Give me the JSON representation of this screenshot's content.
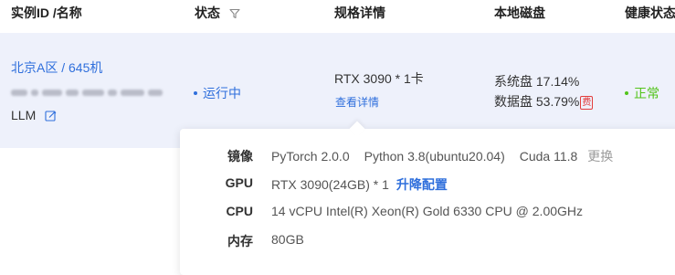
{
  "header": {
    "col_instance": "实例ID /名称",
    "col_status": "状态",
    "col_spec": "规格详情",
    "col_disk": "本地磁盘",
    "col_health": "健康状态"
  },
  "row": {
    "region": "北京A区 / 645机",
    "name": "LLM",
    "status": "运行中",
    "spec": "RTX 3090 * 1卡",
    "spec_link": "查看详情",
    "disk_system": "系统盘 17.14%",
    "disk_data": "数据盘 53.79%",
    "fee_badge": "费",
    "health": "正常"
  },
  "popover": {
    "image_label": "镜像",
    "image_pytorch": "PyTorch  2.0.0",
    "image_python": "Python  3.8(ubuntu20.04)",
    "image_cuda": "Cuda  11.8",
    "image_change": "更换",
    "gpu_label": "GPU",
    "gpu_value": "RTX 3090(24GB) * 1",
    "gpu_action": "升降配置",
    "cpu_label": "CPU",
    "cpu_value": "14 vCPU Intel(R) Xeon(R) Gold 6330 CPU @ 2.00GHz",
    "mem_label": "内存",
    "mem_value": "80GB"
  },
  "colors": {
    "link": "#2f6fdc",
    "running": "#2f6fdc",
    "healthy": "#52c41a",
    "fee": "#e23c3c",
    "row_bg": "#eef1fb"
  },
  "icons": {
    "filter": "filter-icon",
    "edit": "edit-icon"
  }
}
